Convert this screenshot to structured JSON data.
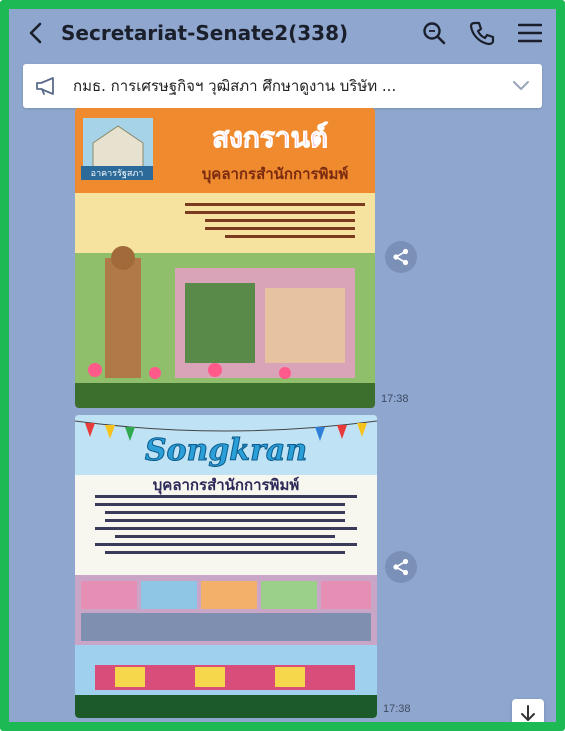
{
  "header": {
    "title": "Secretariat-Senate2(338)",
    "back_icon": "chevron-left-icon",
    "actions": [
      "search-icon",
      "phone-icon",
      "menu-icon"
    ]
  },
  "announcement": {
    "icon": "megaphone-icon",
    "text": "กมธ. การเศรษฐกิจฯ วุฒิสภา ศึกษาดูงาน บริษัท ...",
    "chevron": "chevron-down-icon"
  },
  "messages": [
    {
      "type": "image",
      "time": "17:38",
      "poster": {
        "caption_building": "อาคารรัฐสภา",
        "title": "สงกรานต์",
        "subtitle": "บุคลากรสำนักการพิมพ์"
      }
    },
    {
      "type": "image",
      "time": "17:38",
      "poster": {
        "title": "Songkran",
        "subtitle": "บุคลากรสำนักการพิมพ์"
      }
    }
  ],
  "colors": {
    "frame_border": "#1db954",
    "chat_background": "#8fa7cf"
  }
}
